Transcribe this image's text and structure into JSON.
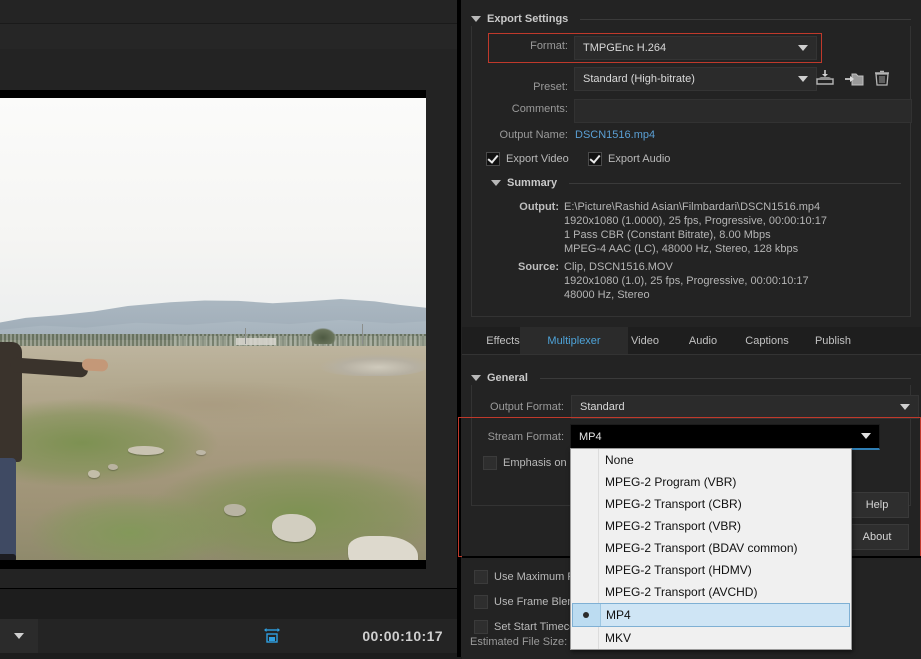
{
  "preview": {
    "timecode": "00:00:10:17",
    "fit_icon": "fit-to-frame-icon",
    "zoom_dropdown_icon": "chevron-down-icon"
  },
  "export_settings": {
    "title": "Export Settings",
    "format": {
      "label": "Format:",
      "value": "TMPGEnc H.264",
      "highlighted": true
    },
    "preset": {
      "label": "Preset:",
      "value": "Standard (High-bitrate)"
    },
    "preset_actions": [
      "save-preset-icon",
      "import-preset-icon",
      "delete-preset-icon"
    ],
    "comments": {
      "label": "Comments:",
      "value": "",
      "placeholder": ""
    },
    "output_name": {
      "label": "Output Name:",
      "value": "DSCN1516.mp4"
    },
    "export_video": {
      "label": "Export Video",
      "checked": true
    },
    "export_audio": {
      "label": "Export Audio",
      "checked": true
    },
    "summary": {
      "title": "Summary",
      "output_label": "Output:",
      "output_lines": [
        "E:\\Picture\\Rashid Asian\\Filmbardari\\DSCN1516.mp4",
        "1920x1080 (1.0000), 25 fps, Progressive, 00:00:10:17",
        "1 Pass CBR (Constant Bitrate), 8.00 Mbps",
        "MPEG-4 AAC (LC), 48000 Hz, Stereo, 128 kbps"
      ],
      "source_label": "Source:",
      "source_lines": [
        "Clip, DSCN1516.MOV",
        "1920x1080 (1.0), 25 fps, Progressive, 00:00:10:17",
        "48000 Hz, Stereo"
      ]
    }
  },
  "tabs": [
    {
      "label": "Effects",
      "active": false
    },
    {
      "label": "Multiplexer",
      "active": true
    },
    {
      "label": "Video",
      "active": false
    },
    {
      "label": "Audio",
      "active": false
    },
    {
      "label": "Captions",
      "active": false
    },
    {
      "label": "Publish",
      "active": false
    }
  ],
  "general": {
    "title": "General",
    "output_format": {
      "label": "Output Format:",
      "value": "Standard"
    },
    "stream_format": {
      "label": "Stream Format:",
      "value": "MP4",
      "open": true
    },
    "emphasis": {
      "label": "Emphasis on p",
      "checked": false
    }
  },
  "stream_format_options": [
    {
      "label": "None",
      "selected": false
    },
    {
      "label": "MPEG-2 Program (VBR)",
      "selected": false
    },
    {
      "label": "MPEG-2 Transport (CBR)",
      "selected": false
    },
    {
      "label": "MPEG-2 Transport (VBR)",
      "selected": false
    },
    {
      "label": "MPEG-2 Transport (BDAV common)",
      "selected": false
    },
    {
      "label": "MPEG-2 Transport (HDMV)",
      "selected": false
    },
    {
      "label": "MPEG-2 Transport (AVCHD)",
      "selected": false
    },
    {
      "label": "MP4",
      "selected": true
    },
    {
      "label": "MKV",
      "selected": false
    }
  ],
  "side_buttons": {
    "help": "Help",
    "about": "About"
  },
  "footer_options": [
    {
      "label": "Use Maximum Re",
      "checked": false
    },
    {
      "label": "Use Frame Blend",
      "checked": false
    },
    {
      "label": "Set Start Timeco",
      "checked": false
    }
  ],
  "estimated_file_size": {
    "label": "Estimated File Size:",
    "value": ""
  },
  "colors": {
    "panel_bg": "#232323",
    "field_bg": "#2b2b2b",
    "accent_blue": "#4ea3d8",
    "link_blue": "#5a9fd4",
    "highlight_red": "#c0392b",
    "menu_bg": "#f0f0f0",
    "menu_selected": "#cfe5f5"
  }
}
